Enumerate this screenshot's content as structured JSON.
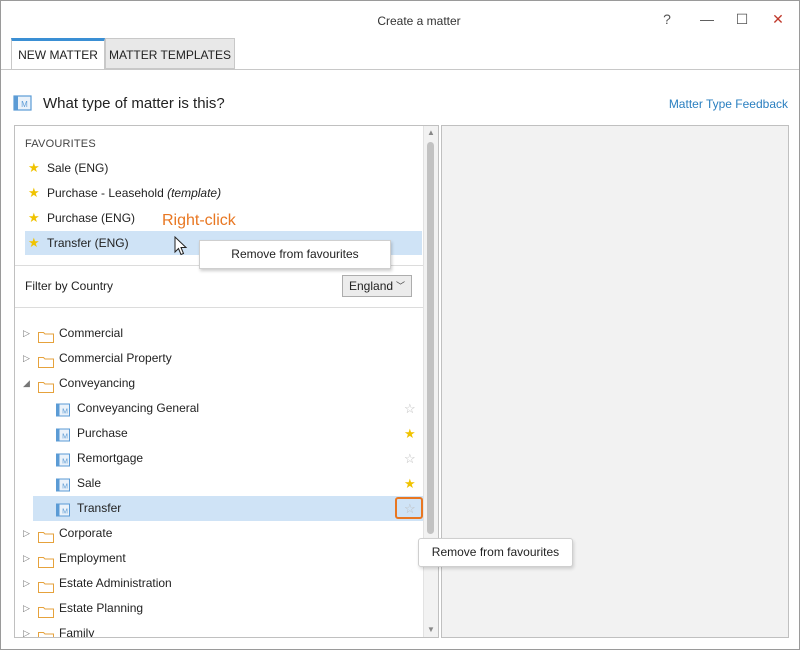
{
  "window": {
    "title": "Create a matter",
    "help": "?",
    "minimize": "—",
    "maximize": "☐",
    "close": "✕"
  },
  "tabs": [
    {
      "label": "NEW MATTER",
      "active": true
    },
    {
      "label": "MATTER TEMPLATES",
      "active": false
    }
  ],
  "header": {
    "question": "What type of matter is this?",
    "feedback_link": "Matter Type Feedback"
  },
  "favourites": {
    "heading": "FAVOURITES",
    "items": [
      {
        "label": "Sale (ENG)",
        "suffix": ""
      },
      {
        "label": "Purchase - Leasehold ",
        "suffix": "(template)"
      },
      {
        "label": "Purchase (ENG)",
        "suffix": ""
      },
      {
        "label": "Transfer (ENG)",
        "suffix": "",
        "selected": true
      }
    ]
  },
  "annotation": {
    "right_click": "Right-click"
  },
  "context_menu": {
    "item": "Remove from favourites"
  },
  "filter": {
    "label": "Filter by Country",
    "value": "England"
  },
  "tree": [
    {
      "label": "Commercial",
      "type": "folder",
      "expanded": false
    },
    {
      "label": "Commercial Property",
      "type": "folder",
      "expanded": false
    },
    {
      "label": "Conveyancing",
      "type": "folder",
      "expanded": true
    },
    {
      "label": "Conveyancing General",
      "type": "matter",
      "favourite": false
    },
    {
      "label": "Purchase",
      "type": "matter",
      "favourite": true
    },
    {
      "label": "Remortgage",
      "type": "matter",
      "favourite": false
    },
    {
      "label": "Sale",
      "type": "matter",
      "favourite": true
    },
    {
      "label": "Transfer",
      "type": "matter",
      "favourite": false,
      "selected": true
    },
    {
      "label": "Corporate",
      "type": "folder",
      "expanded": false
    },
    {
      "label": "Employment",
      "type": "folder",
      "expanded": false
    },
    {
      "label": "Estate Administration",
      "type": "folder",
      "expanded": false
    },
    {
      "label": "Estate Planning",
      "type": "folder",
      "expanded": false
    },
    {
      "label": "Family",
      "type": "folder",
      "expanded": false
    }
  ],
  "tooltip": {
    "text": "Remove from favourites"
  },
  "colors": {
    "accent": "#3a8fd4",
    "selection": "#cfe3f6",
    "star": "#f0c300",
    "highlight": "#e87722",
    "link": "#2a7fc0"
  }
}
